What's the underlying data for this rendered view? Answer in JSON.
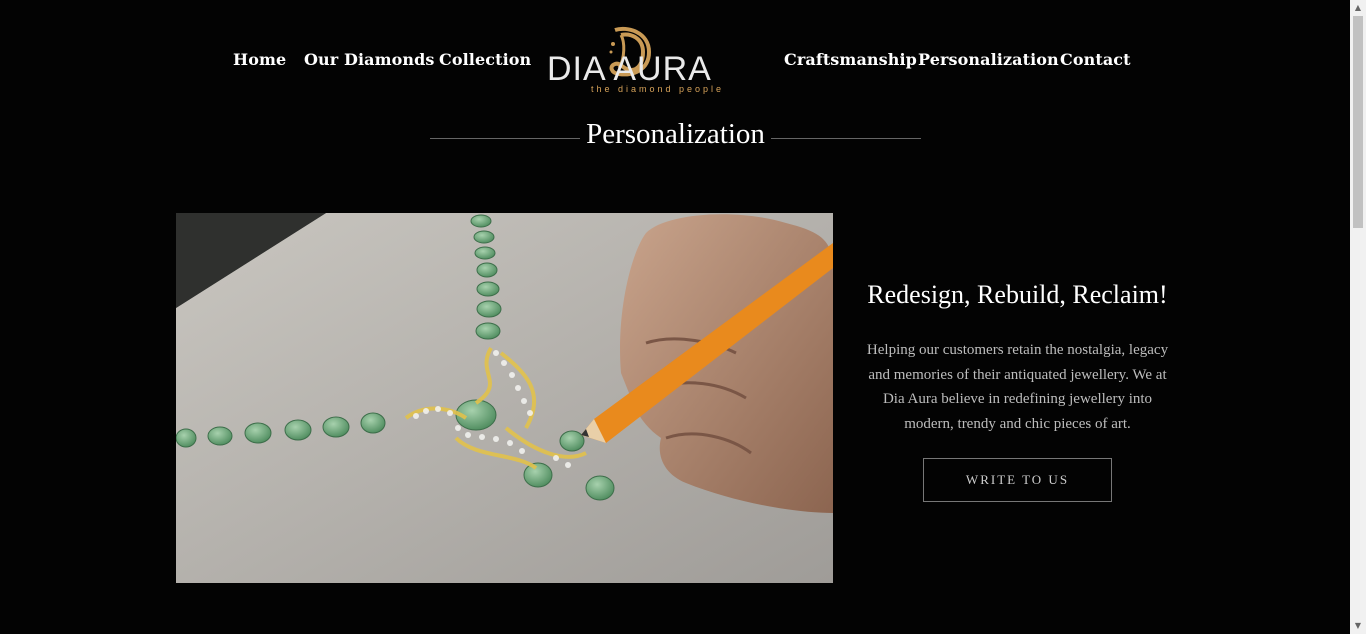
{
  "nav": {
    "links": [
      "Home",
      "Our Diamonds",
      "Collection",
      "Craftsmanship",
      "Personalization",
      "Contact"
    ]
  },
  "logo": {
    "name": "DIA AURA",
    "tagline": "the diamond people"
  },
  "section": {
    "title": "Personalization"
  },
  "feature": {
    "heading": "Redesign, Rebuild, Reclaim!",
    "description": "Helping our customers retain the nostalgia, legacy and memories of their antiquated jewellery. We at Dia Aura believe in redefining jewellery into modern, trendy and chic pieces of art.",
    "cta_label": "WRITE TO US"
  },
  "icons": {
    "scroll_up": "triangle-up-icon",
    "scroll_down": "triangle-down-icon"
  }
}
